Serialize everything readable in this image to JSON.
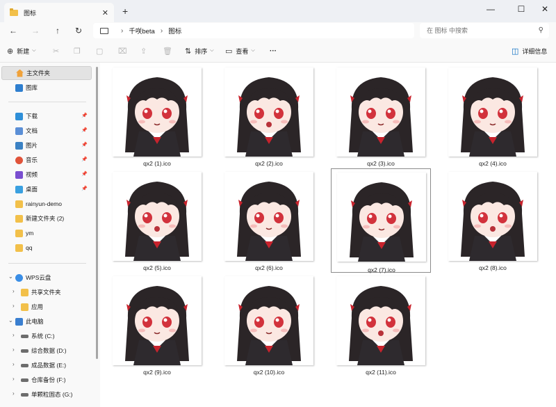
{
  "window": {
    "tab_title": "图标",
    "tab_close": "✕",
    "new_tab": "+",
    "minimize": "—",
    "maximize": "☐",
    "close": "✕"
  },
  "nav": {
    "back": "←",
    "forward": "→",
    "up": "↑",
    "refresh": "↻"
  },
  "address": {
    "crumbs": [
      "千咲beta",
      "图标"
    ],
    "separator": "›"
  },
  "search": {
    "placeholder": "在 图标 中搜索"
  },
  "toolbar": {
    "new_label": "新建",
    "sort_label": "排序",
    "view_label": "查看",
    "more_label": "···",
    "details_label": "详细信息"
  },
  "sidebar": {
    "top": [
      {
        "label": "主文件夹",
        "icon": "home-icon",
        "selected": true
      },
      {
        "label": "图库",
        "icon": "gallery-icon"
      }
    ],
    "pinned": [
      {
        "label": "下载",
        "icon": "download-icon",
        "color": "#2f8fd8"
      },
      {
        "label": "文档",
        "icon": "document-icon",
        "color": "#5b8fd6"
      },
      {
        "label": "图片",
        "icon": "pictures-icon",
        "color": "#3b82c4"
      },
      {
        "label": "音乐",
        "icon": "music-icon",
        "color": "#e0533a"
      },
      {
        "label": "视频",
        "icon": "video-icon",
        "color": "#7a4fd0"
      },
      {
        "label": "桌面",
        "icon": "desktop-icon",
        "color": "#3aa0e0"
      }
    ],
    "folders": [
      {
        "label": "rainyun-demo"
      },
      {
        "label": "新建文件夹 (2)"
      },
      {
        "label": "ym"
      },
      {
        "label": "qq"
      }
    ],
    "cloud": [
      {
        "label": "WPS云盘",
        "icon": "cloud-icon",
        "expanded": true
      },
      {
        "label": "共享文件夹",
        "icon": "shared-folder-icon"
      },
      {
        "label": "应用",
        "icon": "app-folder-icon"
      }
    ],
    "pc": [
      {
        "label": "此电脑",
        "icon": "computer-icon",
        "expanded": true
      },
      {
        "label": "系统 (C:)",
        "icon": "drive-icon"
      },
      {
        "label": "综合数据 (D:)",
        "icon": "drive-icon"
      },
      {
        "label": "成品数据 (E:)",
        "icon": "drive-icon"
      },
      {
        "label": "仓库备份 (F:)",
        "icon": "drive-icon"
      },
      {
        "label": "单颗粒固态 (G:)",
        "icon": "drive-icon"
      }
    ]
  },
  "files": [
    {
      "name": "qx2 (1).ico"
    },
    {
      "name": "qx2 (2).ico"
    },
    {
      "name": "qx2 (3).ico"
    },
    {
      "name": "qx2 (4).ico"
    },
    {
      "name": "qx2 (5).ico"
    },
    {
      "name": "qx2 (6).ico"
    },
    {
      "name": "qx2 (7).ico",
      "selected": true
    },
    {
      "name": "qx2 (8).ico"
    },
    {
      "name": "qx2 (9).ico"
    },
    {
      "name": "qx2 (10).ico"
    },
    {
      "name": "qx2 (11).ico"
    }
  ],
  "colors": {
    "accent": "#0067c0",
    "hair": "#2b2527",
    "skin": "#fbe8e2",
    "eye": "#d2323c",
    "ribbon": "#c8232d",
    "uniform": "#2e2a2e",
    "folder": "#f2c04a"
  }
}
